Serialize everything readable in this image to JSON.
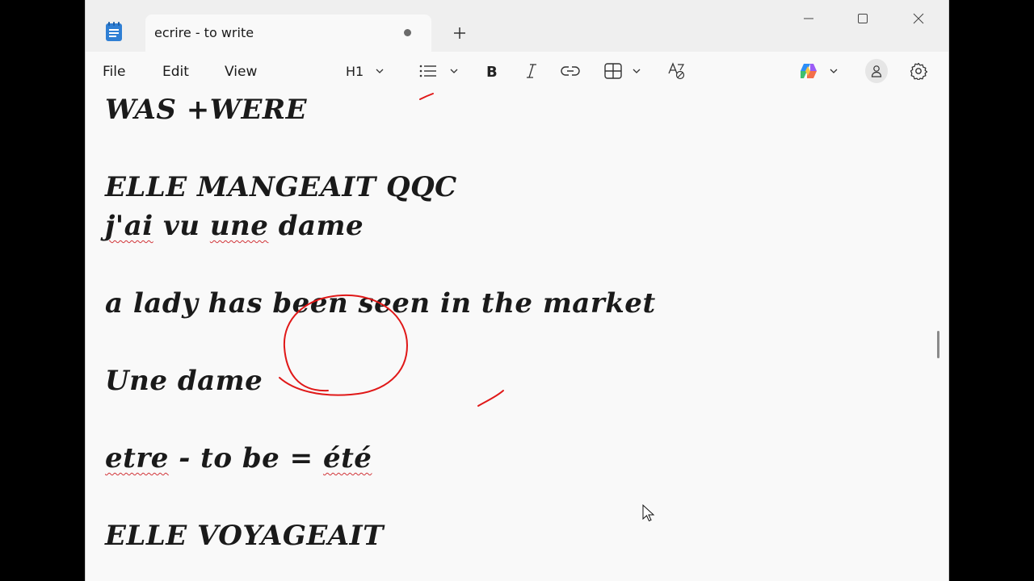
{
  "window": {
    "tab_title": "ecrire - to write"
  },
  "menu": {
    "file": "File",
    "edit": "Edit",
    "view": "View"
  },
  "toolbar": {
    "heading_label": "H1"
  },
  "document": {
    "lines": [
      "WAS +WERE",
      "ELLE MANGEAIT QQC",
      "j'ai vu une dame",
      "a lady has been seen in the market",
      "Une dame",
      "etre - to be = été",
      "ELLE VOYAGEAIT"
    ],
    "line3_parts": [
      "j'ai",
      " vu ",
      "une",
      " dame"
    ],
    "line6_parts": [
      "etre",
      " - to be = ",
      "été"
    ]
  },
  "colors": {
    "ink": "#e01818",
    "spellcheck": "#d13438",
    "window_bg": "#f9f9f9",
    "titlebar_bg": "#efefef"
  }
}
